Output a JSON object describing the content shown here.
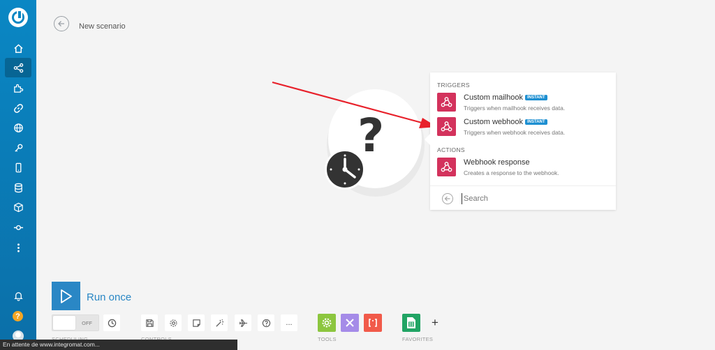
{
  "header": {
    "scenario_title": "New scenario"
  },
  "sidebar": {
    "items": [
      {
        "icon": "home-icon"
      },
      {
        "icon": "share-icon",
        "active": true
      },
      {
        "icon": "puzzle-icon"
      },
      {
        "icon": "link-icon"
      },
      {
        "icon": "globe-icon"
      },
      {
        "icon": "key-icon"
      },
      {
        "icon": "phone-icon"
      },
      {
        "icon": "database-icon"
      },
      {
        "icon": "box-icon"
      },
      {
        "icon": "flow-icon"
      },
      {
        "icon": "more-icon"
      }
    ],
    "bottom": [
      {
        "icon": "bell-icon"
      },
      {
        "icon": "help-icon",
        "label": "?"
      },
      {
        "icon": "avatar-icon"
      }
    ]
  },
  "popup": {
    "triggers_label": "TRIGGERS",
    "actions_label": "ACTIONS",
    "triggers": [
      {
        "title": "Custom mailhook",
        "badge": "INSTANT",
        "description": "Triggers when mailhook receives data."
      },
      {
        "title": "Custom webhook",
        "badge": "INSTANT",
        "description": "Triggers when webhook receives data."
      }
    ],
    "actions": [
      {
        "title": "Webhook response",
        "description": "Creates a response to the webhook."
      }
    ],
    "search_placeholder": "Search"
  },
  "toolbar": {
    "run_label": "Run once",
    "toggle_label": "OFF",
    "scheduling_label": "SCHEDULING",
    "controls_label": "CONTROLS",
    "tools_label": "TOOLS",
    "favorites_label": "FAVORITES",
    "more_label": "..."
  },
  "statusbar": {
    "text": "En attente de www.integromat.com..."
  },
  "colors": {
    "sidebar": "#0a87c4",
    "accent": "#2a87c5",
    "webhook": "#d3325c",
    "badge": "#1d8fd1",
    "arrow": "#e8202a",
    "tool_green": "#8cc63f",
    "tool_purple": "#a58be8",
    "tool_orange": "#f15a4a",
    "sheets_green": "#21a464"
  }
}
